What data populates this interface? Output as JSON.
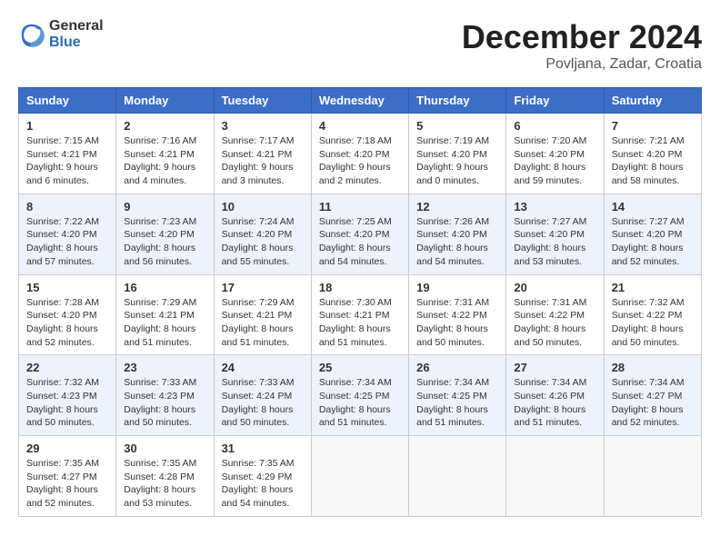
{
  "header": {
    "logo_general": "General",
    "logo_blue": "Blue",
    "month_title": "December 2024",
    "location": "Povljana, Zadar, Croatia"
  },
  "days_of_week": [
    "Sunday",
    "Monday",
    "Tuesday",
    "Wednesday",
    "Thursday",
    "Friday",
    "Saturday"
  ],
  "weeks": [
    [
      {
        "day": "1",
        "info": "Sunrise: 7:15 AM\nSunset: 4:21 PM\nDaylight: 9 hours\nand 6 minutes."
      },
      {
        "day": "2",
        "info": "Sunrise: 7:16 AM\nSunset: 4:21 PM\nDaylight: 9 hours\nand 4 minutes."
      },
      {
        "day": "3",
        "info": "Sunrise: 7:17 AM\nSunset: 4:21 PM\nDaylight: 9 hours\nand 3 minutes."
      },
      {
        "day": "4",
        "info": "Sunrise: 7:18 AM\nSunset: 4:20 PM\nDaylight: 9 hours\nand 2 minutes."
      },
      {
        "day": "5",
        "info": "Sunrise: 7:19 AM\nSunset: 4:20 PM\nDaylight: 9 hours\nand 0 minutes."
      },
      {
        "day": "6",
        "info": "Sunrise: 7:20 AM\nSunset: 4:20 PM\nDaylight: 8 hours\nand 59 minutes."
      },
      {
        "day": "7",
        "info": "Sunrise: 7:21 AM\nSunset: 4:20 PM\nDaylight: 8 hours\nand 58 minutes."
      }
    ],
    [
      {
        "day": "8",
        "info": "Sunrise: 7:22 AM\nSunset: 4:20 PM\nDaylight: 8 hours\nand 57 minutes."
      },
      {
        "day": "9",
        "info": "Sunrise: 7:23 AM\nSunset: 4:20 PM\nDaylight: 8 hours\nand 56 minutes."
      },
      {
        "day": "10",
        "info": "Sunrise: 7:24 AM\nSunset: 4:20 PM\nDaylight: 8 hours\nand 55 minutes."
      },
      {
        "day": "11",
        "info": "Sunrise: 7:25 AM\nSunset: 4:20 PM\nDaylight: 8 hours\nand 54 minutes."
      },
      {
        "day": "12",
        "info": "Sunrise: 7:26 AM\nSunset: 4:20 PM\nDaylight: 8 hours\nand 54 minutes."
      },
      {
        "day": "13",
        "info": "Sunrise: 7:27 AM\nSunset: 4:20 PM\nDaylight: 8 hours\nand 53 minutes."
      },
      {
        "day": "14",
        "info": "Sunrise: 7:27 AM\nSunset: 4:20 PM\nDaylight: 8 hours\nand 52 minutes."
      }
    ],
    [
      {
        "day": "15",
        "info": "Sunrise: 7:28 AM\nSunset: 4:20 PM\nDaylight: 8 hours\nand 52 minutes."
      },
      {
        "day": "16",
        "info": "Sunrise: 7:29 AM\nSunset: 4:21 PM\nDaylight: 8 hours\nand 51 minutes."
      },
      {
        "day": "17",
        "info": "Sunrise: 7:29 AM\nSunset: 4:21 PM\nDaylight: 8 hours\nand 51 minutes."
      },
      {
        "day": "18",
        "info": "Sunrise: 7:30 AM\nSunset: 4:21 PM\nDaylight: 8 hours\nand 51 minutes."
      },
      {
        "day": "19",
        "info": "Sunrise: 7:31 AM\nSunset: 4:22 PM\nDaylight: 8 hours\nand 50 minutes."
      },
      {
        "day": "20",
        "info": "Sunrise: 7:31 AM\nSunset: 4:22 PM\nDaylight: 8 hours\nand 50 minutes."
      },
      {
        "day": "21",
        "info": "Sunrise: 7:32 AM\nSunset: 4:22 PM\nDaylight: 8 hours\nand 50 minutes."
      }
    ],
    [
      {
        "day": "22",
        "info": "Sunrise: 7:32 AM\nSunset: 4:23 PM\nDaylight: 8 hours\nand 50 minutes."
      },
      {
        "day": "23",
        "info": "Sunrise: 7:33 AM\nSunset: 4:23 PM\nDaylight: 8 hours\nand 50 minutes."
      },
      {
        "day": "24",
        "info": "Sunrise: 7:33 AM\nSunset: 4:24 PM\nDaylight: 8 hours\nand 50 minutes."
      },
      {
        "day": "25",
        "info": "Sunrise: 7:34 AM\nSunset: 4:25 PM\nDaylight: 8 hours\nand 51 minutes."
      },
      {
        "day": "26",
        "info": "Sunrise: 7:34 AM\nSunset: 4:25 PM\nDaylight: 8 hours\nand 51 minutes."
      },
      {
        "day": "27",
        "info": "Sunrise: 7:34 AM\nSunset: 4:26 PM\nDaylight: 8 hours\nand 51 minutes."
      },
      {
        "day": "28",
        "info": "Sunrise: 7:34 AM\nSunset: 4:27 PM\nDaylight: 8 hours\nand 52 minutes."
      }
    ],
    [
      {
        "day": "29",
        "info": "Sunrise: 7:35 AM\nSunset: 4:27 PM\nDaylight: 8 hours\nand 52 minutes."
      },
      {
        "day": "30",
        "info": "Sunrise: 7:35 AM\nSunset: 4:28 PM\nDaylight: 8 hours\nand 53 minutes."
      },
      {
        "day": "31",
        "info": "Sunrise: 7:35 AM\nSunset: 4:29 PM\nDaylight: 8 hours\nand 54 minutes."
      },
      {
        "day": "",
        "info": ""
      },
      {
        "day": "",
        "info": ""
      },
      {
        "day": "",
        "info": ""
      },
      {
        "day": "",
        "info": ""
      }
    ]
  ]
}
